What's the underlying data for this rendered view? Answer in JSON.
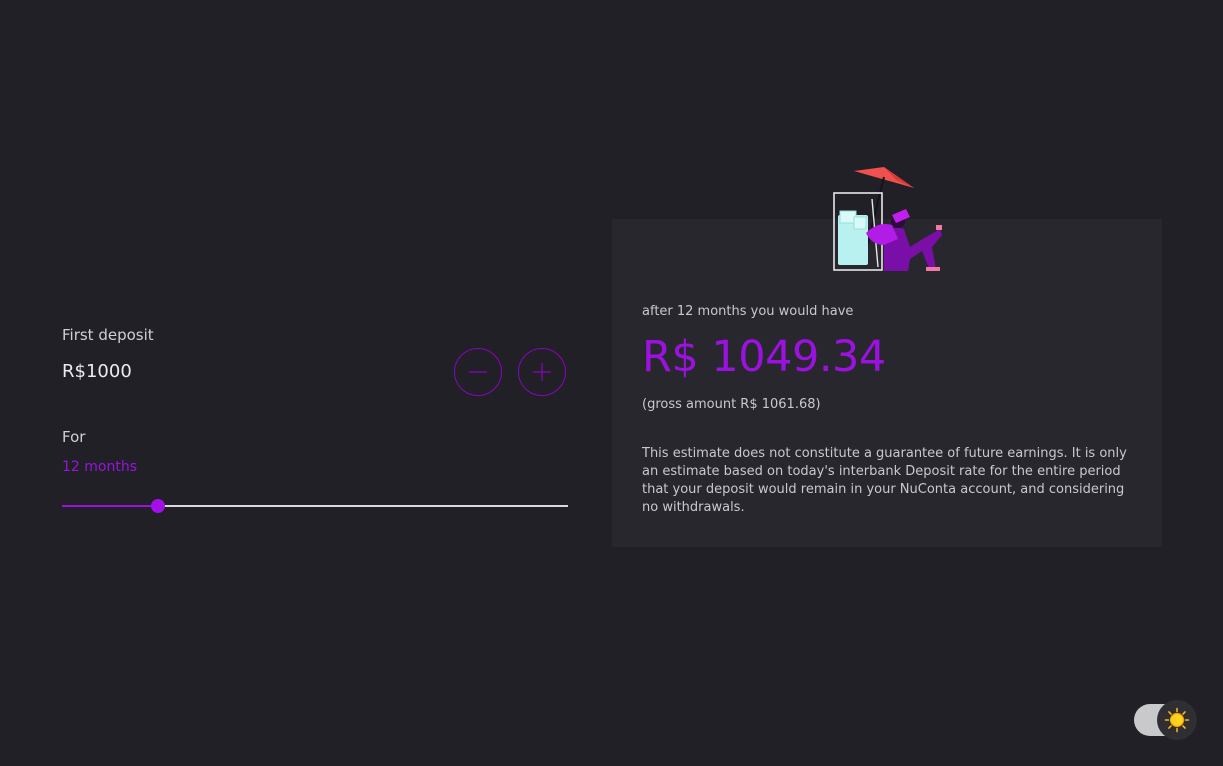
{
  "deposit": {
    "label": "First deposit",
    "value": "R$1000",
    "decrease_icon": "minus-icon",
    "increase_icon": "plus-icon"
  },
  "period": {
    "label": "For",
    "value": "12 months",
    "slider_fraction": 0.19
  },
  "result": {
    "intro": "after 12 months you would have",
    "amount": "R$ 1049.34",
    "gross": "(gross amount R$ 1061.68)",
    "disclaimer": "This estimate does not constitute a guarantee of future earnings. It is only an estimate based on today's interbank Deposit rate for the entire period that your deposit would remain in your NuConta account, and considering no withdrawals.",
    "illustration": "person-relaxing-with-drink-illustration"
  },
  "theme_toggle": {
    "icon": "sun-icon",
    "state": "light"
  },
  "colors": {
    "background": "#212027",
    "card": "#28272e",
    "accent": "#9b12e0",
    "text": "#d6d4dc"
  }
}
